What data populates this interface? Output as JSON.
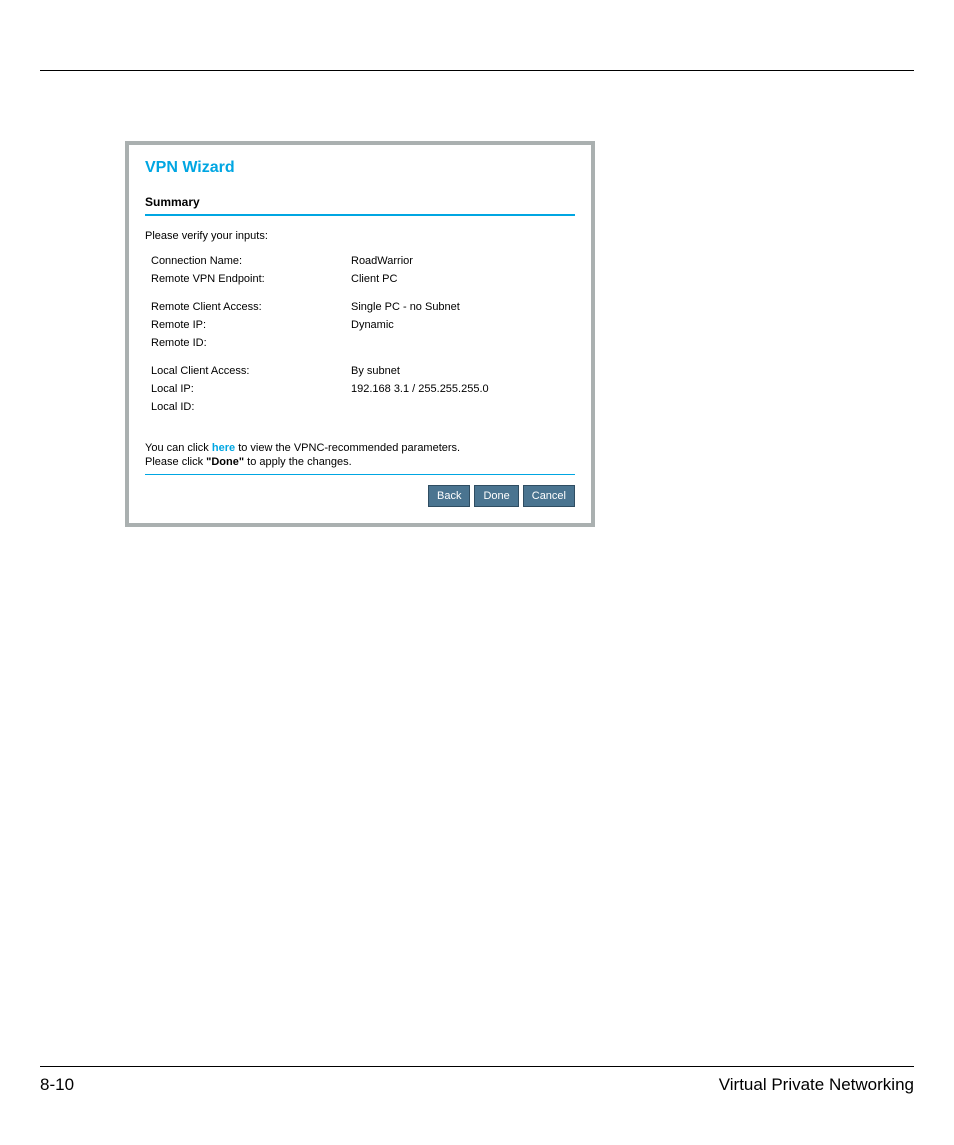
{
  "wizard": {
    "title": "VPN Wizard",
    "section": "Summary",
    "verify_prompt": "Please verify your inputs:",
    "group1": {
      "connection_name_label": "Connection Name:",
      "connection_name_value": "RoadWarrior",
      "remote_endpoint_label": "Remote VPN Endpoint:",
      "remote_endpoint_value": "Client PC"
    },
    "group2": {
      "remote_client_access_label": "Remote Client Access:",
      "remote_client_access_value": "Single PC - no Subnet",
      "remote_ip_label": "Remote IP:",
      "remote_ip_value": "Dynamic",
      "remote_id_label": "Remote ID:",
      "remote_id_value": ""
    },
    "group3": {
      "local_client_access_label": "Local Client Access:",
      "local_client_access_value": "By subnet",
      "local_ip_label": "Local IP:",
      "local_ip_value": "192.168 3.1 / 255.255.255.0",
      "local_id_label": "Local ID:",
      "local_id_value": ""
    },
    "hint_pre": "You can click",
    "hint_link": "here",
    "hint_post": "to view the VPNC-recommended parameters.",
    "apply_pre": "Please click",
    "apply_bold": "\"Done\"",
    "apply_post": "to apply the changes.",
    "buttons": {
      "back": "Back",
      "done": "Done",
      "cancel": "Cancel"
    }
  },
  "footer": {
    "page_number": "8-10",
    "chapter": "Virtual Private Networking"
  }
}
